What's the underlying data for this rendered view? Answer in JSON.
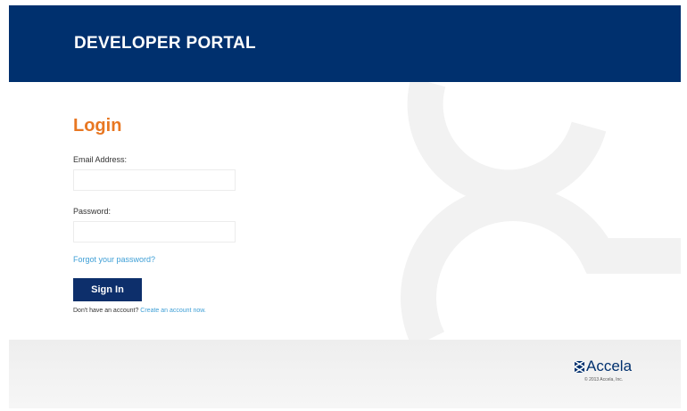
{
  "header": {
    "title": "DEVELOPER PORTAL"
  },
  "login": {
    "title": "Login",
    "email_label": "Email Address:",
    "email_value": "",
    "password_label": "Password:",
    "password_value": "",
    "forgot_link": "Forgot your password?",
    "signin_button": "Sign In",
    "no_account_text": "Don't have an account?",
    "create_account_link": "Create an account now."
  },
  "footer": {
    "brand_name": "Accela",
    "copyright": "© 2013 Accela, Inc."
  },
  "icons": {
    "background_graphic": "accela-arc-watermark",
    "brand_mark": "accela-logo-icon"
  },
  "colors": {
    "header_bg": "#00306e",
    "login_title": "#e87722",
    "link": "#3e9fd6",
    "button_bg": "#0d2f6b"
  }
}
